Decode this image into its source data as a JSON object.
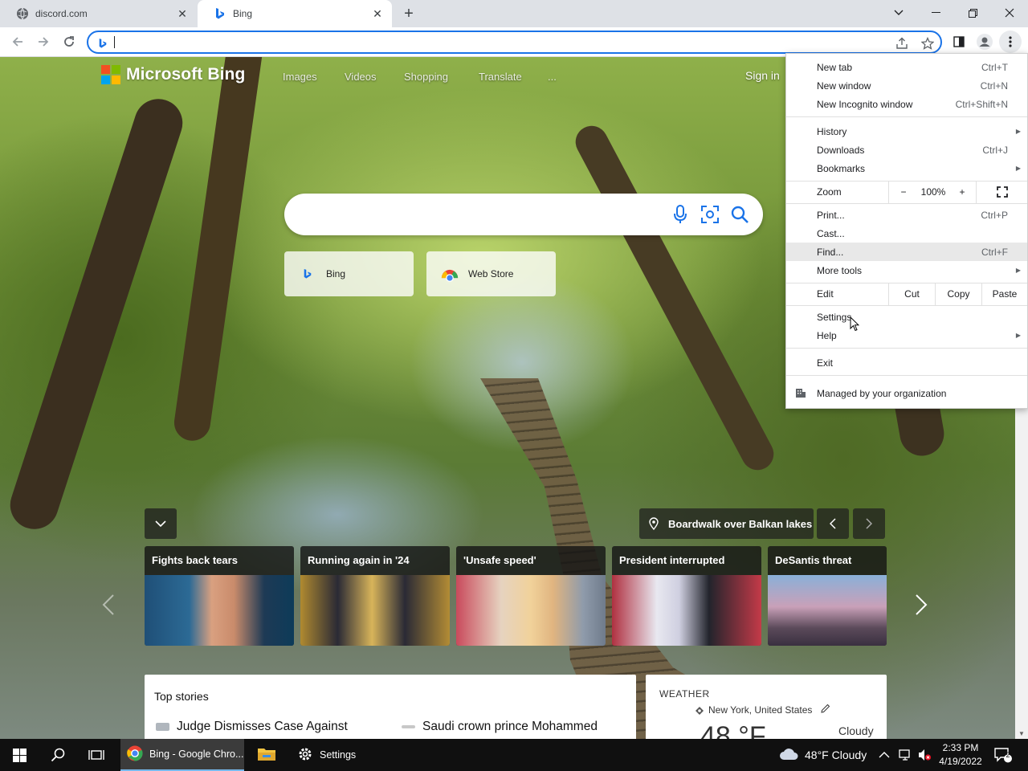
{
  "tabs": [
    {
      "title": "discord.com",
      "favicon": "globe-icon",
      "active": false
    },
    {
      "title": "Bing",
      "favicon": "bing-icon",
      "active": true
    }
  ],
  "omnibox": {
    "value": "",
    "placeholder": ""
  },
  "bing": {
    "logo_text": "Microsoft Bing",
    "nav": [
      "Images",
      "Videos",
      "Shopping",
      "Translate",
      "..."
    ],
    "sign_in": "Sign in",
    "search_placeholder": "",
    "quick_links": [
      "Bing",
      "Web Store"
    ],
    "location_caption": "Boardwalk over Balkan lakes",
    "news_cards": [
      "Fights back tears",
      "Running again in '24",
      "'Unsafe speed'",
      "President interrupted",
      "DeSantis threat"
    ],
    "top_stories_title": "Top stories",
    "stories": [
      "Judge Dismisses Case Against",
      "Saudi crown prince Mohammed"
    ],
    "weather": {
      "label": "WEATHER",
      "location": "New York, United States",
      "temp": "48 °F",
      "condition": "Cloudy"
    }
  },
  "menu": {
    "new_tab": {
      "label": "New tab",
      "shortcut": "Ctrl+T"
    },
    "new_window": {
      "label": "New window",
      "shortcut": "Ctrl+N"
    },
    "new_incognito": {
      "label": "New Incognito window",
      "shortcut": "Ctrl+Shift+N"
    },
    "history": {
      "label": "History"
    },
    "downloads": {
      "label": "Downloads",
      "shortcut": "Ctrl+J"
    },
    "bookmarks": {
      "label": "Bookmarks"
    },
    "zoom": {
      "label": "Zoom",
      "minus": "−",
      "level": "100%",
      "plus": "+"
    },
    "print": {
      "label": "Print...",
      "shortcut": "Ctrl+P"
    },
    "cast": {
      "label": "Cast..."
    },
    "find": {
      "label": "Find...",
      "shortcut": "Ctrl+F"
    },
    "more_tools": {
      "label": "More tools"
    },
    "edit": {
      "label": "Edit",
      "cut": "Cut",
      "copy": "Copy",
      "paste": "Paste"
    },
    "settings": {
      "label": "Settings"
    },
    "help": {
      "label": "Help"
    },
    "exit": {
      "label": "Exit"
    },
    "managed": {
      "label": "Managed by your organization"
    }
  },
  "taskbar": {
    "apps": [
      {
        "label": "Bing - Google Chro...",
        "icon": "chrome-icon",
        "active": true
      },
      {
        "label": "",
        "icon": "file-explorer-icon",
        "active": false
      },
      {
        "label": "Settings",
        "icon": "settings-gear-icon",
        "active": false
      }
    ],
    "weather": "48°F  Cloudy",
    "time": "2:33 PM",
    "date": "4/19/2022",
    "notification_count": "2"
  },
  "colors": {
    "accent": "#1a73e8",
    "menu_hover": "#e8e8e8",
    "taskbar": "#101010"
  }
}
